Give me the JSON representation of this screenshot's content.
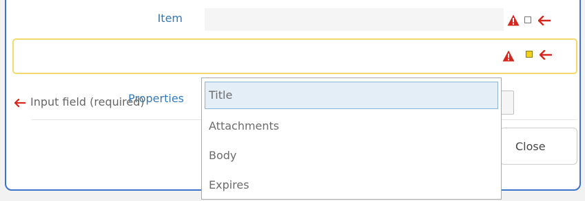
{
  "form": {
    "item_label": "Item",
    "properties_label": "Properties",
    "note_text": "Input field (required)",
    "close_label": "Close"
  },
  "dropdown": {
    "options": [
      "Title",
      "Attachments",
      "Body",
      "Expires"
    ],
    "highlighted": "Title"
  },
  "colors": {
    "label_blue": "#3479b7",
    "warning_red": "#d7261e",
    "highlight_yellow": "#f4d96b",
    "dialog_border": "#3b73c8"
  },
  "icons": {
    "warning": "warning-triangle-icon",
    "arrow": "left-arrow-icon",
    "status_box": "status-square-icon"
  }
}
